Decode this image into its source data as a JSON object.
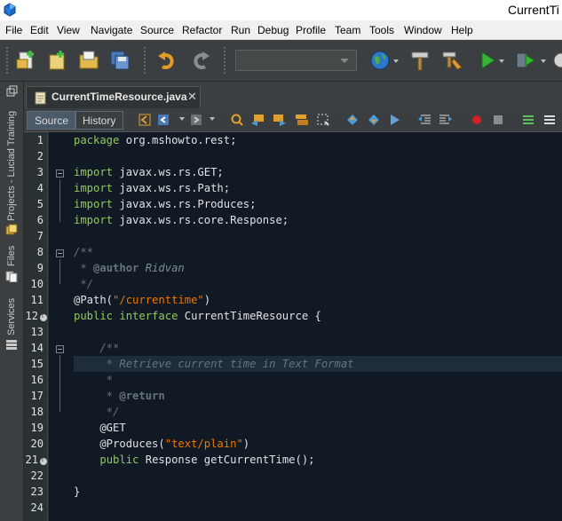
{
  "window": {
    "title": "CurrentTi"
  },
  "menu": [
    "File",
    "Edit",
    "View",
    "Navigate",
    "Source",
    "Refactor",
    "Run",
    "Debug",
    "Profile",
    "Team",
    "Tools",
    "Window",
    "Help"
  ],
  "side": {
    "projects": "Projects - Luciad Training",
    "files": "Files",
    "services": "Services"
  },
  "editor": {
    "file_tab": "CurrentTimeResource.java",
    "source_tab": "Source",
    "history_tab": "History",
    "line_numbers": [
      "1",
      "2",
      "3",
      "4",
      "5",
      "6",
      "7",
      "8",
      "9",
      "10",
      "11",
      "12",
      "13",
      "14",
      "15",
      "16",
      "17",
      "18",
      "19",
      "20",
      "21",
      "22",
      "23",
      "24"
    ]
  },
  "colors": {
    "keyword": "#93c763",
    "string": "#ec7600",
    "comment": "#66747b",
    "background": "#111a24"
  },
  "code": {
    "l1_kw": "package",
    "l1_rest": " org.mshowto.rest;",
    "l3_kw": "import",
    "l3_rest": " javax.ws.rs.GET;",
    "l4_kw": "import",
    "l4_rest": " javax.ws.rs.Path;",
    "l5_kw": "import",
    "l5_rest": " javax.ws.rs.Produces;",
    "l6_kw": "import",
    "l6_rest": " javax.ws.rs.core.Response;",
    "l8": "/**",
    "l9_star": " * ",
    "l9_tag": "@author",
    "l9_name": " Ridvan",
    "l10": " */",
    "l11_ann": "@Path(",
    "l11_str": "\"/currenttime\"",
    "l11_end": ")",
    "l12_kw1": "public",
    "l12_kw2": " interface",
    "l12_rest": " CurrentTimeResource {",
    "l14": "    /**",
    "l15": "     * Retrieve current time in Text Format",
    "l16": "     *",
    "l17_star": "     * ",
    "l17_tag": "@return",
    "l18": "     */",
    "l19": "    @GET",
    "l20_ann": "    @Produces(",
    "l20_str": "\"text/plain\"",
    "l20_end": ")",
    "l21_ind": "    ",
    "l21_kw": "public",
    "l21_rest": " Response getCurrentTime();",
    "l23": "}"
  }
}
